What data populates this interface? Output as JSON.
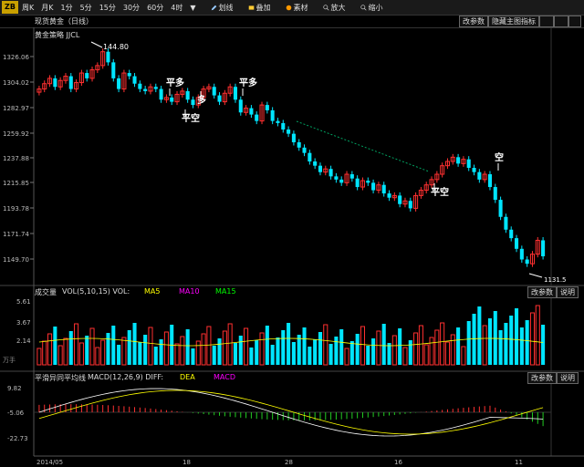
{
  "toolbar": {
    "logo": "ZB",
    "items": [
      "周K",
      "月K",
      "1分",
      "5分",
      "15分",
      "30分",
      "60分",
      "4时"
    ],
    "dropdown_arrow": "▼",
    "tools": [
      {
        "label": "划线",
        "icon": "pencil-icon"
      },
      {
        "label": "叠加",
        "icon": "overlay-icon"
      },
      {
        "label": "素材",
        "icon": "material-icon"
      },
      {
        "label": "放大",
        "icon": "zoom-in-icon"
      },
      {
        "label": "缩小",
        "icon": "zoom-out-icon"
      }
    ]
  },
  "instrument": "现货黄金（日线）",
  "main_chart": {
    "strategy_label": "黄金策略 JJCL",
    "buttons": [
      "改参数",
      "隐藏主图指标"
    ],
    "high_marker": "144.80",
    "low_marker": "1131.5",
    "y_ticks": [
      "1326.06",
      "1304.02",
      "1282.97",
      "1259.92",
      "1237.88",
      "1215.85",
      "1193.78",
      "1171.74",
      "1149.70"
    ],
    "signals": [
      {
        "label": "平多",
        "type": "close-long"
      },
      {
        "label": "多",
        "type": "long"
      },
      {
        "label": "平空",
        "type": "close-short"
      },
      {
        "label": "平多",
        "type": "close-long"
      },
      {
        "label": "平空",
        "type": "close-short"
      },
      {
        "label": "空",
        "type": "short"
      }
    ],
    "colors": {
      "up": "#ff3030",
      "down": "#00e5ff",
      "dashed": "#00a060"
    }
  },
  "volume_pane": {
    "title": "成交量",
    "indicator": "VOL(5,10,15) VOL:",
    "legend": [
      {
        "label": "MA5",
        "color": "#ffff00"
      },
      {
        "label": "MA10",
        "color": "#ff00ff"
      },
      {
        "label": "MA15",
        "color": "#00ff00"
      }
    ],
    "y_ticks": [
      "5.61",
      "3.67",
      "2.14"
    ],
    "unit": "万手",
    "buttons": [
      "改参数",
      "说明"
    ]
  },
  "macd_pane": {
    "title": "平滑异同平均线",
    "indicator": "MACD(12,26,9) DIFF:",
    "legend": [
      {
        "label": "DEA",
        "color": "#ffff00"
      },
      {
        "label": "MACD",
        "color": "#ff00ff"
      }
    ],
    "y_ticks": [
      "9.82",
      "-5.06",
      "-22.73"
    ],
    "buttons": [
      "改参数",
      "说明"
    ]
  },
  "x_axis": [
    "2014/05",
    "18",
    "28",
    "16",
    "11"
  ]
}
